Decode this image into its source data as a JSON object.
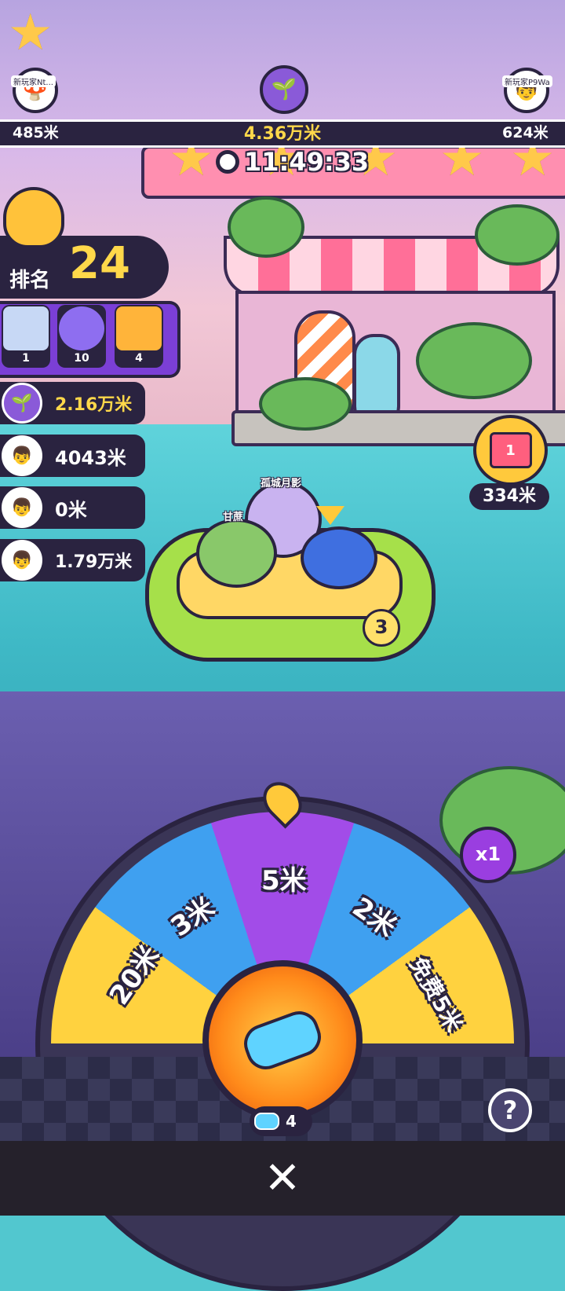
{
  "top": {
    "left_player": {
      "name": "新玩家Nt...",
      "distance": "485米"
    },
    "center_distance": "4.36万米",
    "right_player": {
      "name": "新玩家P9Wa",
      "distance": "624米"
    }
  },
  "timer": "11:49:33",
  "rank": {
    "label": "排名",
    "value": "24"
  },
  "items": [
    {
      "icon": "mystery-box-icon",
      "count": "1"
    },
    {
      "icon": "capsule-icon",
      "count": "10"
    },
    {
      "icon": "ticket-icon",
      "count": "4"
    }
  ],
  "players": [
    {
      "distance": "2.16万米",
      "highlight": true
    },
    {
      "distance": "4043米",
      "highlight": false
    },
    {
      "distance": "0米",
      "highlight": false
    },
    {
      "distance": "1.79万米",
      "highlight": false
    }
  ],
  "gift": {
    "badge": "1",
    "distance": "334米"
  },
  "boat": {
    "number": "3",
    "characters": [
      {
        "name": "孤城月影"
      },
      {
        "name": "甘蔗"
      }
    ]
  },
  "wheel": {
    "segments": [
      "20米",
      "3米",
      "5米",
      "2米",
      "免费5米"
    ],
    "multiplier": "x1",
    "tickets": "4"
  },
  "help_label": "?",
  "close_label": "✕",
  "colors": {
    "panel": "#2a2340",
    "gold": "#ffd84a",
    "purple": "#a24ce8",
    "blue": "#3fa0f0",
    "yellow": "#ffd23f"
  }
}
